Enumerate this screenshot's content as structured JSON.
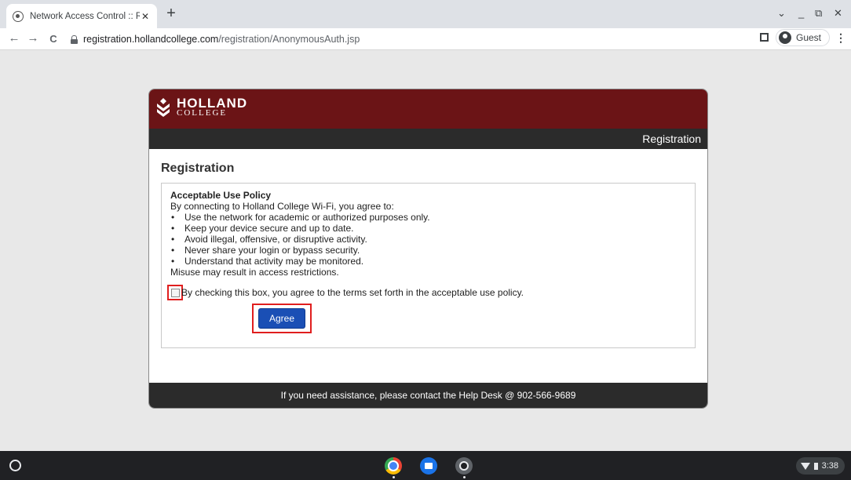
{
  "browser": {
    "tab_title": "Network Access Control :: Regist",
    "tab_close": "✕",
    "new_tab": "+",
    "url_host": "registration.hollandcollege.com",
    "url_path": "/registration/AnonymousAuth.jsp",
    "back": "←",
    "forward": "→",
    "reload": "C",
    "profile_label": "Guest",
    "menu": "⋮",
    "window_controls": {
      "dropdown": "⌄",
      "minimize": "_",
      "restore": "⧉",
      "close": "✕"
    }
  },
  "page": {
    "logo_name": "HOLLAND",
    "logo_sub": "COLLEGE",
    "header_bar_label": "Registration",
    "heading": "Registration",
    "policy": {
      "title": "Acceptable Use Policy",
      "intro": "By connecting to Holland College Wi-Fi, you agree to:",
      "items": [
        "Use the network for academic or authorized purposes only.",
        "Keep your device secure and up to date.",
        "Avoid illegal, offensive, or disruptive activity.",
        "Never share your login or bypass security.",
        "Understand that activity may be monitored."
      ],
      "closing": "Misuse may result in access restrictions."
    },
    "checkbox_label": "By checking this box, you agree to the terms set forth in the acceptable use policy.",
    "agree_button": "Agree",
    "footer": "If you need assistance, please contact the Help Desk @ 902-566-9689"
  },
  "shelf": {
    "time": "3:38"
  },
  "colors": {
    "brand": "#6b1416",
    "button": "#1a4fb5",
    "highlight": "#e01e1e"
  }
}
